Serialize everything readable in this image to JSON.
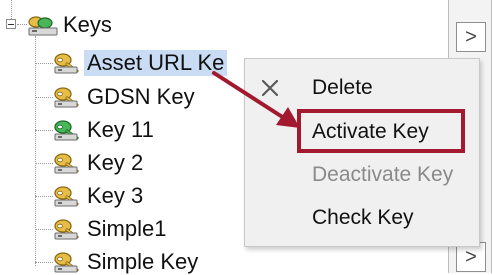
{
  "tree": {
    "root": {
      "label": "Keys",
      "icon": "keys-folder-icon"
    },
    "items": [
      {
        "label": "Asset URL Ke",
        "icon": "key-icon",
        "selected": true
      },
      {
        "label": "GDSN Key",
        "icon": "key-icon"
      },
      {
        "label": "Key 11",
        "icon": "active-key-icon"
      },
      {
        "label": "Key 2",
        "icon": "key-icon"
      },
      {
        "label": "Key 3",
        "icon": "key-icon"
      },
      {
        "label": "Simple1",
        "icon": "key-icon"
      },
      {
        "label": "Simple Key",
        "icon": "key-icon"
      }
    ]
  },
  "scrollbar": {
    "button_glyph": ">"
  },
  "context_menu": {
    "items": [
      {
        "label": "Delete",
        "icon": "close-icon",
        "enabled": true
      },
      {
        "label": "Activate Key",
        "enabled": true,
        "highlighted": true
      },
      {
        "label": "Deactivate Key",
        "enabled": false
      },
      {
        "label": "Check Key",
        "enabled": true
      }
    ]
  },
  "colors": {
    "selection": "#c9dcf4",
    "callout": "#a3192f",
    "key_gold": "#e0b33c",
    "key_green": "#3aa84c"
  }
}
